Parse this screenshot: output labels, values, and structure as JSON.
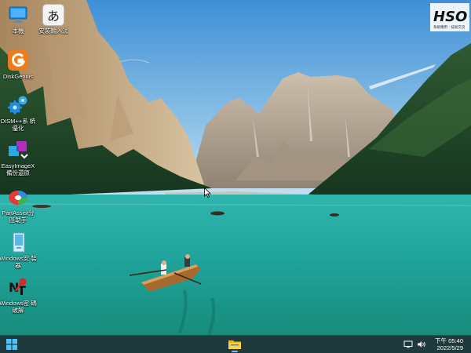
{
  "desktop": {
    "icons": [
      {
        "label": "本機",
        "icon": "computer-icon"
      },
      {
        "label": "安裝輸入法",
        "icon": "ime-icon"
      },
      {
        "label": "DiskGenius",
        "icon": "diskgenius-icon"
      },
      {
        "label": "DISM++系 統優化",
        "icon": "gears-icon"
      },
      {
        "label": "EasyImageX 備份還原",
        "icon": "easyimagex-icon"
      },
      {
        "label": "PartAssist分 區助手",
        "icon": "partassist-icon"
      },
      {
        "label": "Windows安 裝器",
        "icon": "windows-installer-icon"
      },
      {
        "label": "Windows密 碼破解",
        "icon": "nt-password-icon"
      }
    ],
    "ime_glyph": "あ",
    "logo_text": "HSO",
    "logo_subtext": "系統應用 · 技術交流"
  },
  "taskbar": {
    "start_icon": "windows-logo-icon",
    "pinned": [
      {
        "icon": "file-explorer-icon"
      }
    ],
    "tray": {
      "network_icon": "network-icon",
      "volume_icon": "volume-icon",
      "time": "下午 05:40",
      "date": "2022/5/29"
    }
  },
  "colors": {
    "taskbar": "#1f3a3c",
    "lake": "#1fa6a0",
    "sky": "#6aa9d8"
  }
}
